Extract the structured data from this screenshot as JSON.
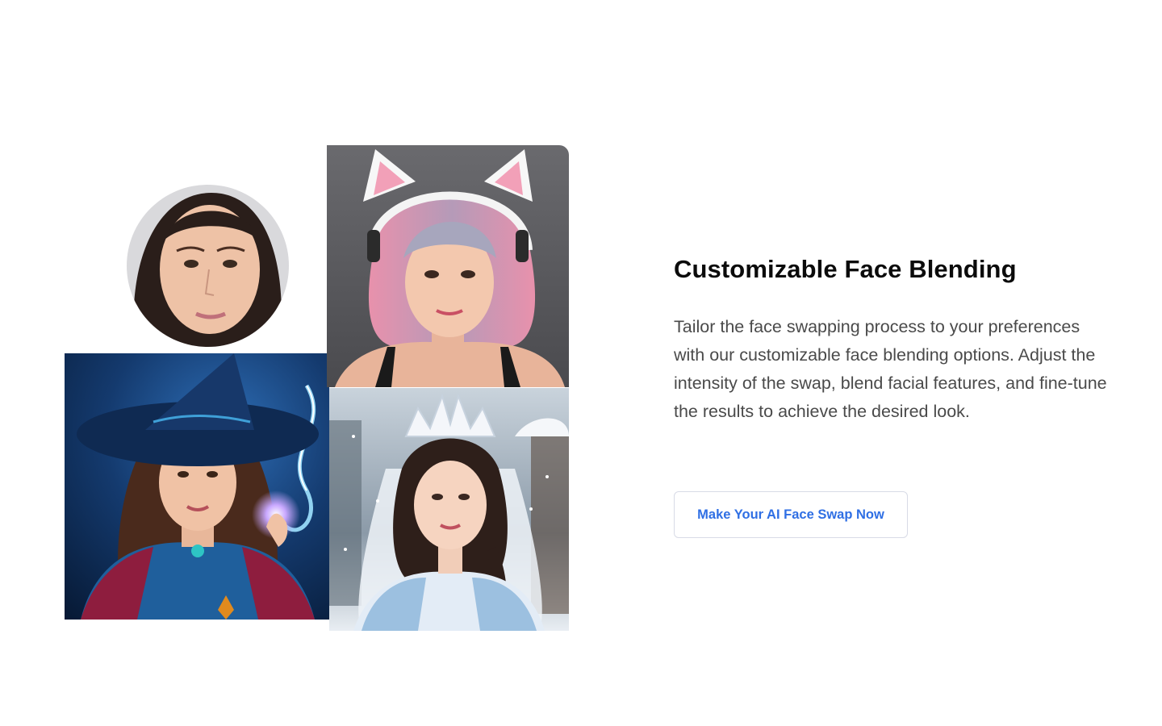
{
  "feature": {
    "title": "Customizable Face Blending",
    "description": "Tailor the face swapping process to your preferences with our customizable face blending options. Adjust the intensity of the swap, blend facial features, and fine-tune the results to achieve the desired look.",
    "cta_label": "Make Your AI Face Swap Now"
  },
  "collage": {
    "images": [
      "source-face-photo",
      "cat-ear-headphones-portrait",
      "witch-portrait",
      "snow-princess-portrait"
    ]
  },
  "colors": {
    "title": "#0b0b0b",
    "body_text": "#4a4a4a",
    "cta_text": "#2f6fe4",
    "cta_border": "#d8dbe6"
  }
}
